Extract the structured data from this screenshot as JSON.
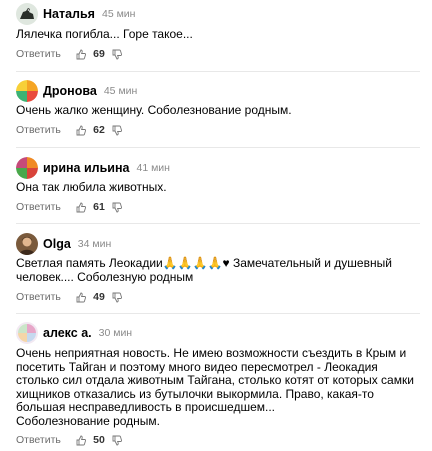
{
  "reply_label": "Ответить",
  "comments": [
    {
      "author": "Наталья",
      "time": "45 мин",
      "text": "Лялечка погибла... Горе такое...",
      "likes": "69",
      "avatar_icon": "dog-avatar-icon"
    },
    {
      "author": "Дронова",
      "time": "45 мин",
      "text": "Очень жалко женщину. Соболезнование родным.",
      "likes": "62",
      "avatar_icon": "colorful-avatar-icon"
    },
    {
      "author": "ирина ильина",
      "time": "41 мин",
      "text": "Она так любила животных.",
      "likes": "61",
      "avatar_icon": "colorful-avatar-icon"
    },
    {
      "author": "Olga",
      "time": "34 мин",
      "text": "Светлая память Леокадии🙏🙏🙏🙏♥ Замечательный и душевный человек.... Соболезную родным",
      "likes": "49",
      "avatar_icon": "photo-avatar-icon"
    },
    {
      "author": "алекс а.",
      "time": "30 мин",
      "text": "Очень неприятная новость. Не имею возможности съездить в Крым и посетить Тайган и поэтому много видео пересмотрел - Леокадия столько сил отдала животным Тайгана, столько котят от которых самки хищников отказались из бутылочки выкормила. Право, какая-то большая несправедливость в происшедшем...\nСоболезнование родным.",
      "likes": "50",
      "avatar_icon": "colorful-avatar-icon"
    }
  ]
}
